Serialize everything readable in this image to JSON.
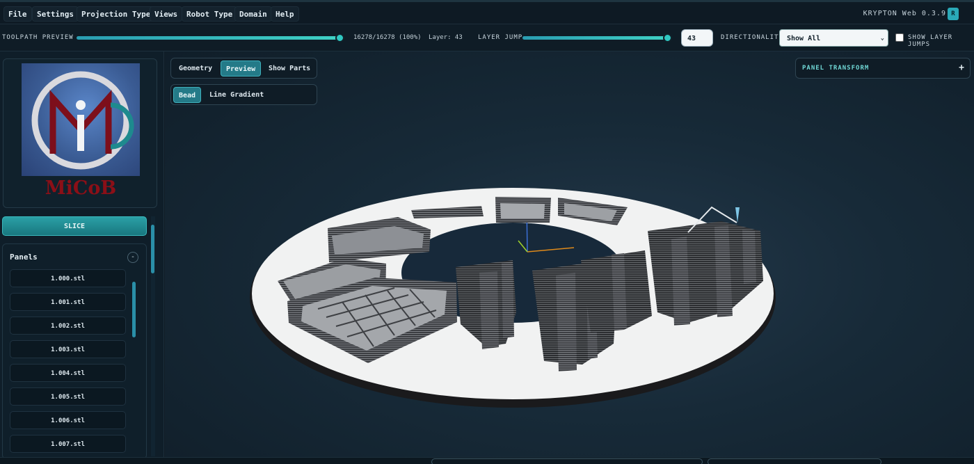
{
  "menu": {
    "items": [
      "File",
      "Settings",
      "Projection Type",
      "Views",
      "Robot Type",
      "Domain",
      "Help"
    ],
    "brand": "KRYPTON Web 0.3.9",
    "badge": "R"
  },
  "toolbar": {
    "toolpath_label": "TOOLPATH PREVIEW",
    "toolpath_progress": "16278/16278 (100%)",
    "toolpath_fraction": 1.0,
    "layer_text": "Layer: 43",
    "layer_jump_label": "LAYER JUMP",
    "layer_jump_fraction": 1.0,
    "layer_jump_value": "43",
    "directionality_label": "DIRECTIONALITY",
    "directionality_value": "Show All",
    "show_layer_jumps_label": "SHOW LAYER JUMPS",
    "show_layer_jumps_checked": false
  },
  "sidebar": {
    "logo_text": "MiCoB",
    "slice_label": "SLICE",
    "panels_title": "Panels",
    "panels_collapse": "-",
    "panels": [
      "1.000.stl",
      "1.001.stl",
      "1.002.stl",
      "1.003.stl",
      "1.004.stl",
      "1.005.stl",
      "1.006.stl",
      "1.007.stl"
    ]
  },
  "viewport": {
    "view_tabs": [
      "Geometry",
      "Preview",
      "Show Parts"
    ],
    "active_view_tab": "Preview",
    "render_tabs": [
      "Bead",
      "Line Gradient"
    ],
    "active_render_tab": "Bead",
    "panel_transform_label": "PANEL TRANSFORM",
    "panel_transform_toggle": "+"
  },
  "colors": {
    "accent": "#2aa9b8",
    "slider": "#30c8c2",
    "logo_red": "#8b0f17",
    "background": "#0f1b25"
  }
}
